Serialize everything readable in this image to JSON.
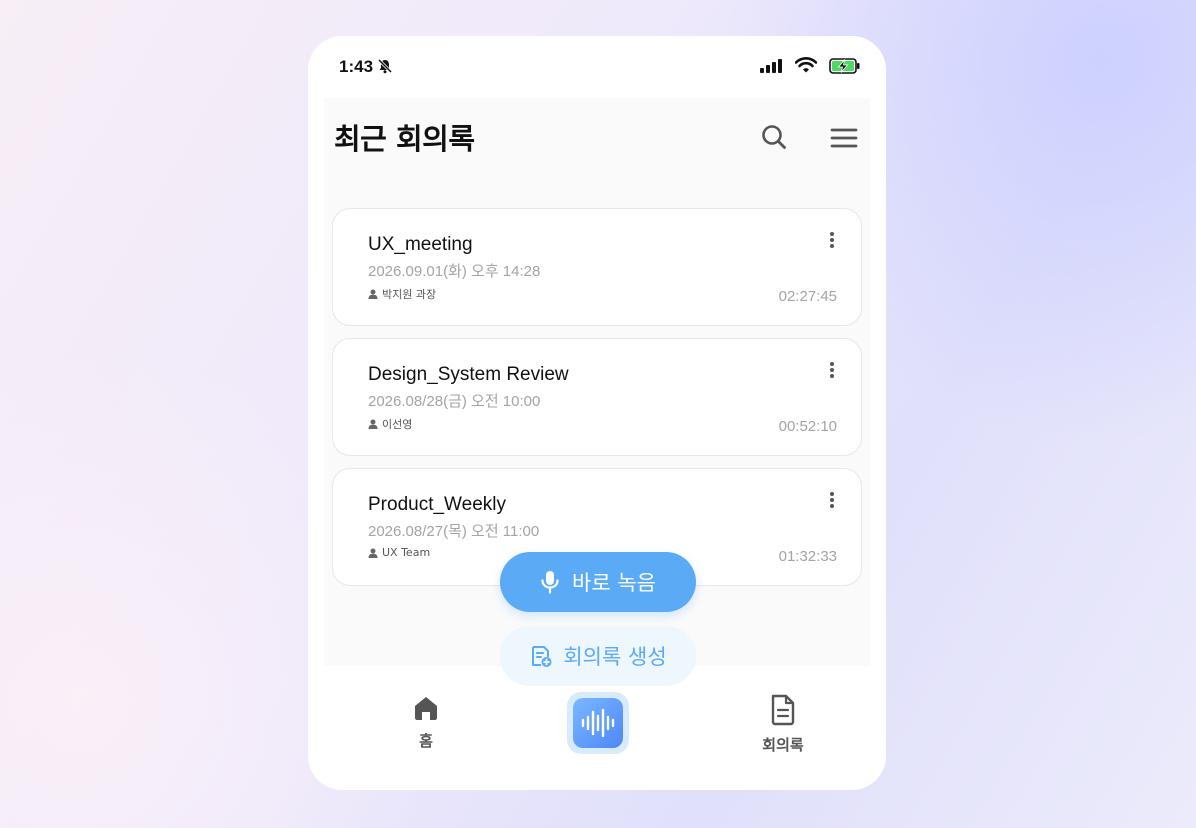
{
  "status_bar": {
    "time": "1:43"
  },
  "header": {
    "title": "최근 회의록"
  },
  "meetings": [
    {
      "title": "UX_meeting",
      "date": "2026.09.01(화) 오후 14:28",
      "owner": "박지원 과장",
      "duration": "02:27:45"
    },
    {
      "title": "Design_System Review",
      "date": "2026.08/28(금) 오전 10:00",
      "owner": "이선영",
      "duration": "00:52:10"
    },
    {
      "title": "Product_Weekly",
      "date": "2026.08/27(목) 오전 11:00",
      "owner": "UX Team",
      "duration": "01:32:33"
    }
  ],
  "actions": {
    "record_now": "바로 녹음",
    "create_minutes": "회의록 생성"
  },
  "tabbar": {
    "home": "홈",
    "minutes": "회의록"
  },
  "colors": {
    "accent": "#5aaaf6",
    "accent_light": "#eef6fe",
    "record_gradient_start": "#7ab8ff",
    "record_gradient_end": "#4f86f7"
  },
  "icons": [
    "bell-off-icon",
    "signal-icon",
    "wifi-icon",
    "battery-charging-icon",
    "search-icon",
    "menu-icon",
    "more-vertical-icon",
    "person-icon",
    "microphone-icon",
    "document-add-icon",
    "home-icon",
    "waveform-icon",
    "document-icon"
  ]
}
